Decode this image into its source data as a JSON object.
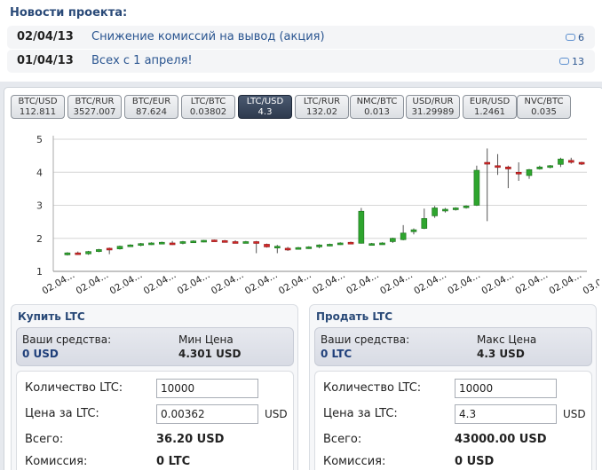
{
  "news": {
    "title": "Новости проекта:",
    "items": [
      {
        "date": "02/04/13",
        "text": "Снижение комиссий на вывод (акция)",
        "comments": "6"
      },
      {
        "date": "01/04/13",
        "text": "Всех с 1 апреля!",
        "comments": "13"
      }
    ]
  },
  "tickers": [
    {
      "pair": "BTC/USD",
      "rate": "112.811",
      "active": false
    },
    {
      "pair": "BTC/RUR",
      "rate": "3527.007",
      "active": false
    },
    {
      "pair": "BTC/EUR",
      "rate": "87.624",
      "active": false
    },
    {
      "pair": "LTC/BTC",
      "rate": "0.03802",
      "active": false
    },
    {
      "pair": "LTC/USD",
      "rate": "4.3",
      "active": true
    },
    {
      "pair": "LTC/RUR",
      "rate": "132.02",
      "active": false
    },
    {
      "pair": "NMC/BTC",
      "rate": "0.013",
      "active": false
    },
    {
      "pair": "USD/RUR",
      "rate": "31.29989",
      "active": false
    },
    {
      "pair": "EUR/USD",
      "rate": "1.2461",
      "active": false
    },
    {
      "pair": "NVC/BTC",
      "rate": "0.035",
      "active": false
    }
  ],
  "colors": {
    "up": "#2ea52e",
    "down": "#d42828",
    "active_tab": "#34415a",
    "accent": "#2a4a78"
  },
  "chart_data": {
    "type": "candlestick",
    "ylim": [
      1,
      5
    ],
    "yticks": [
      "1",
      "2",
      "3",
      "4",
      "5"
    ],
    "xticks": [
      "02.04...",
      "02.04...",
      "02.04...",
      "02.04...",
      "02.04...",
      "02.04...",
      "02.04...",
      "02.04...",
      "02.04...",
      "02.04...",
      "02.04...",
      "02.04...",
      "02.04...",
      "02.04...",
      "02.04...",
      "02.04...",
      "03.04..."
    ],
    "candles": [
      {
        "o": 1.5,
        "h": 1.58,
        "l": 1.48,
        "c": 1.56
      },
      {
        "o": 1.56,
        "h": 1.6,
        "l": 1.5,
        "c": 1.52
      },
      {
        "o": 1.53,
        "h": 1.62,
        "l": 1.5,
        "c": 1.6
      },
      {
        "o": 1.6,
        "h": 1.68,
        "l": 1.58,
        "c": 1.66
      },
      {
        "o": 1.7,
        "h": 1.72,
        "l": 1.52,
        "c": 1.66
      },
      {
        "o": 1.68,
        "h": 1.78,
        "l": 1.66,
        "c": 1.76
      },
      {
        "o": 1.76,
        "h": 1.82,
        "l": 1.74,
        "c": 1.8
      },
      {
        "o": 1.8,
        "h": 1.86,
        "l": 1.76,
        "c": 1.84
      },
      {
        "o": 1.84,
        "h": 1.88,
        "l": 1.8,
        "c": 1.86
      },
      {
        "o": 1.86,
        "h": 1.9,
        "l": 1.82,
        "c": 1.88
      },
      {
        "o": 1.86,
        "h": 1.92,
        "l": 1.8,
        "c": 1.84
      },
      {
        "o": 1.85,
        "h": 1.92,
        "l": 1.82,
        "c": 1.9
      },
      {
        "o": 1.9,
        "h": 1.94,
        "l": 1.86,
        "c": 1.92
      },
      {
        "o": 1.93,
        "h": 1.95,
        "l": 1.88,
        "c": 1.94
      },
      {
        "o": 1.95,
        "h": 1.96,
        "l": 1.9,
        "c": 1.94
      },
      {
        "o": 1.93,
        "h": 1.95,
        "l": 1.88,
        "c": 1.9
      },
      {
        "o": 1.9,
        "h": 1.94,
        "l": 1.85,
        "c": 1.88
      },
      {
        "o": 1.88,
        "h": 1.92,
        "l": 1.86,
        "c": 1.9
      },
      {
        "o": 1.9,
        "h": 1.92,
        "l": 1.55,
        "c": 1.86
      },
      {
        "o": 1.82,
        "h": 1.84,
        "l": 1.72,
        "c": 1.74
      },
      {
        "o": 1.72,
        "h": 1.8,
        "l": 1.55,
        "c": 1.76
      },
      {
        "o": 1.7,
        "h": 1.74,
        "l": 1.62,
        "c": 1.66
      },
      {
        "o": 1.68,
        "h": 1.74,
        "l": 1.66,
        "c": 1.72
      },
      {
        "o": 1.72,
        "h": 1.76,
        "l": 1.68,
        "c": 1.74
      },
      {
        "o": 1.74,
        "h": 1.82,
        "l": 1.7,
        "c": 1.8
      },
      {
        "o": 1.8,
        "h": 1.84,
        "l": 1.76,
        "c": 1.82
      },
      {
        "o": 1.82,
        "h": 1.88,
        "l": 1.8,
        "c": 1.86
      },
      {
        "o": 1.88,
        "h": 1.9,
        "l": 1.82,
        "c": 1.84
      },
      {
        "o": 1.85,
        "h": 2.92,
        "l": 1.84,
        "c": 2.82
      },
      {
        "o": 1.82,
        "h": 1.86,
        "l": 1.8,
        "c": 1.84
      },
      {
        "o": 1.84,
        "h": 1.88,
        "l": 1.82,
        "c": 1.86
      },
      {
        "o": 1.9,
        "h": 2.02,
        "l": 1.86,
        "c": 2.0
      },
      {
        "o": 1.96,
        "h": 2.4,
        "l": 1.94,
        "c": 2.16
      },
      {
        "o": 2.2,
        "h": 2.3,
        "l": 2.12,
        "c": 2.26
      },
      {
        "o": 2.3,
        "h": 2.9,
        "l": 2.28,
        "c": 2.6
      },
      {
        "o": 2.68,
        "h": 2.98,
        "l": 2.62,
        "c": 2.92
      },
      {
        "o": 2.86,
        "h": 2.92,
        "l": 2.78,
        "c": 2.88
      },
      {
        "o": 2.88,
        "h": 2.94,
        "l": 2.84,
        "c": 2.92
      },
      {
        "o": 2.94,
        "h": 3.0,
        "l": 2.9,
        "c": 2.98
      },
      {
        "o": 3.0,
        "h": 4.2,
        "l": 2.98,
        "c": 4.06
      },
      {
        "o": 4.3,
        "h": 4.72,
        "l": 2.52,
        "c": 4.28
      },
      {
        "o": 4.2,
        "h": 4.55,
        "l": 3.92,
        "c": 4.16
      },
      {
        "o": 4.16,
        "h": 4.2,
        "l": 3.52,
        "c": 4.1
      },
      {
        "o": 4.0,
        "h": 4.3,
        "l": 3.74,
        "c": 3.96
      },
      {
        "o": 3.9,
        "h": 4.1,
        "l": 3.8,
        "c": 4.08
      },
      {
        "o": 4.1,
        "h": 4.2,
        "l": 4.08,
        "c": 4.16
      },
      {
        "o": 4.16,
        "h": 4.22,
        "l": 4.12,
        "c": 4.2
      },
      {
        "o": 4.24,
        "h": 4.44,
        "l": 4.16,
        "c": 4.4
      },
      {
        "o": 4.36,
        "h": 4.44,
        "l": 4.26,
        "c": 4.3
      },
      {
        "o": 4.3,
        "h": 4.32,
        "l": 4.22,
        "c": 4.26
      }
    ]
  },
  "buy": {
    "title": "Купить LTC",
    "funds_label": "Ваши средства:",
    "funds_value": "0 USD",
    "price_label": "Мин Цена",
    "price_value": "4.301 USD",
    "amount_label": "Количество LTC:",
    "amount_value": "10000",
    "rate_label": "Цена за LTC:",
    "rate_value": "0.00362",
    "rate_unit": "USD",
    "total_label": "Всего:",
    "total_value": "36.20 USD",
    "fee_label": "Комиссия:",
    "fee_value": "0 LTC"
  },
  "sell": {
    "title": "Продать LTC",
    "funds_label": "Ваши средства:",
    "funds_value": "0 LTC",
    "price_label": "Макс Цена",
    "price_value": "4.3 USD",
    "amount_label": "Количество LTC:",
    "amount_value": "10000",
    "rate_label": "Цена за LTC:",
    "rate_value": "4.3",
    "rate_unit": "USD",
    "total_label": "Всего:",
    "total_value": "43000.00 USD",
    "fee_label": "Комиссия:",
    "fee_value": "0 USD"
  }
}
